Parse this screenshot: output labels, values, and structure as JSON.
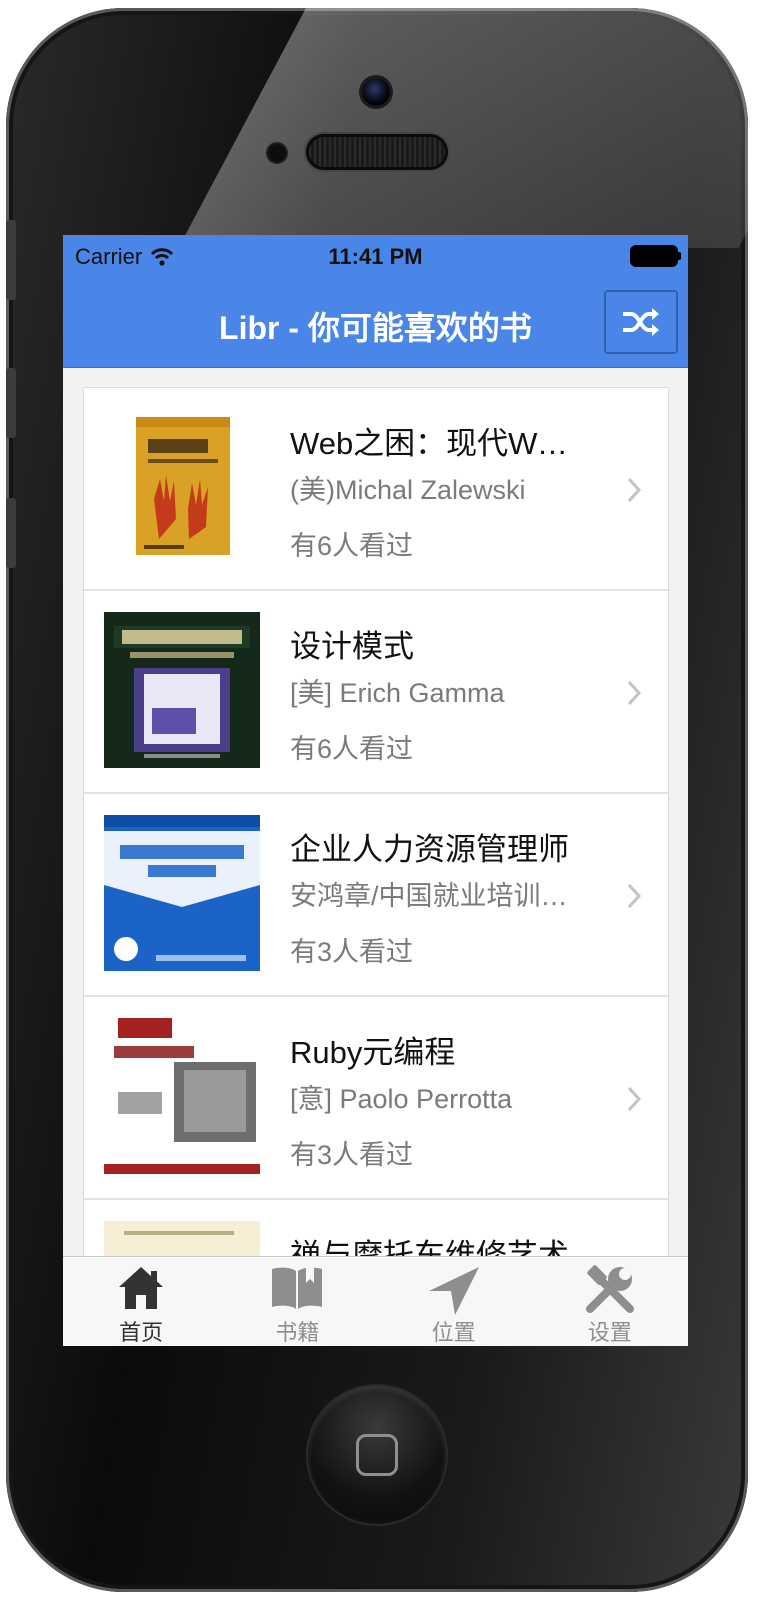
{
  "status_bar": {
    "carrier": "Carrier",
    "time": "11:41 PM"
  },
  "nav": {
    "title": "Libr - 你可能喜欢的书",
    "action_icon": "shuffle-icon"
  },
  "books": [
    {
      "title": "Web之困：现代Web应用安全指南",
      "author": "(美)Michal Zalewski",
      "views": "有6人看过"
    },
    {
      "title": "设计模式",
      "author": "[美] Erich Gamma",
      "views": "有6人看过"
    },
    {
      "title": "企业人力资源管理师",
      "author": "安鸿章/中国就业培训技术指导中心",
      "views": "有3人看过"
    },
    {
      "title": "Ruby元编程",
      "author": "[意] Paolo Perrotta",
      "views": "有3人看过"
    },
    {
      "title": "禅与摩托车维修艺术",
      "author": "",
      "views": ""
    }
  ],
  "tabs": [
    {
      "label": "首页",
      "icon": "home-icon",
      "active": true
    },
    {
      "label": "书籍",
      "icon": "book-icon",
      "active": false
    },
    {
      "label": "位置",
      "icon": "location-arrow-icon",
      "active": false
    },
    {
      "label": "设置",
      "icon": "tools-icon",
      "active": false
    }
  ],
  "colors": {
    "nav_background": "#4a86e8",
    "tab_active": "#333333",
    "tab_inactive": "#8e8e8e"
  }
}
